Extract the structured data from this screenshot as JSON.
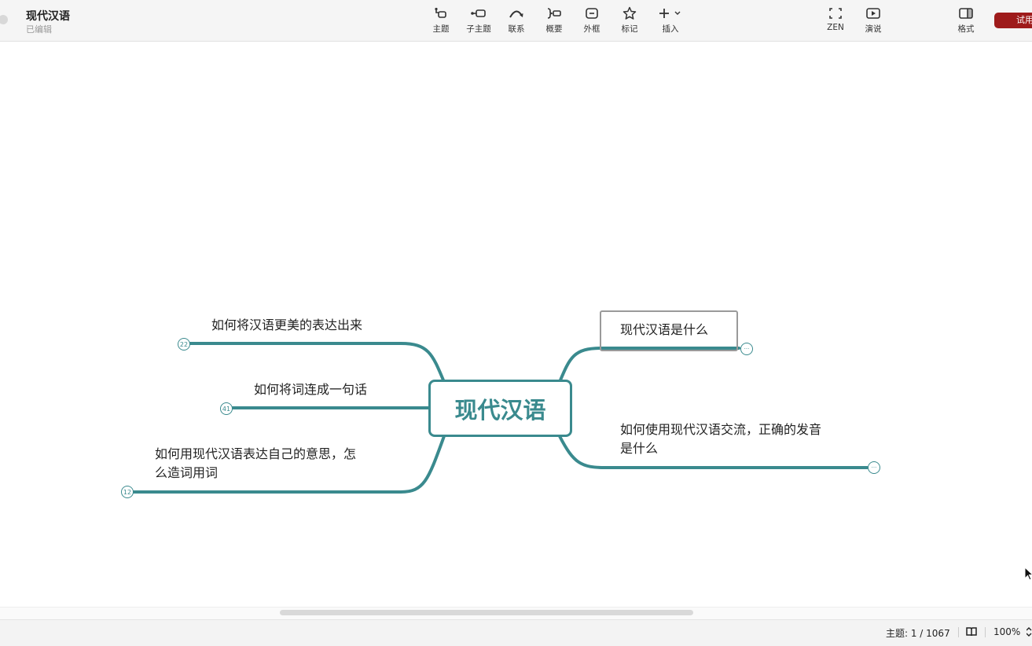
{
  "window": {
    "title": "现代汉语",
    "status": "已编辑"
  },
  "toolbar": {
    "items": [
      {
        "label": "主题",
        "icon": "topic-icon"
      },
      {
        "label": "子主题",
        "icon": "subtopic-icon"
      },
      {
        "label": "联系",
        "icon": "relationship-icon"
      },
      {
        "label": "概要",
        "icon": "summary-icon"
      },
      {
        "label": "外框",
        "icon": "boundary-icon"
      },
      {
        "label": "标记",
        "icon": "star-icon"
      },
      {
        "label": "插入",
        "icon": "plus-icon"
      }
    ],
    "zen_label": "ZEN",
    "present_label": "演说",
    "format_label": "格式",
    "trial_label": "试用"
  },
  "mindmap": {
    "central_topic": "现代汉语",
    "accent_color": "#3a8a8e",
    "left_branches": [
      {
        "text": "如何将汉语更美的表达出来",
        "collapsed_count": "22"
      },
      {
        "text": "如何将词连成一句话",
        "collapsed_count": "41"
      },
      {
        "text_line1": "如何用现代汉语表达自己的意思，怎",
        "text_line2": "么造词用词",
        "collapsed_count": "12"
      }
    ],
    "right_branches": [
      {
        "text": "现代汉语是什么",
        "collapsed_indicator": "···",
        "selected": true
      },
      {
        "text_line1": "如何使用现代汉语交流，正确的发音",
        "text_line2": "是什么",
        "collapsed_indicator": "···"
      }
    ]
  },
  "statusbar": {
    "topics": "主题: 1 / 1067",
    "zoom": "100%"
  }
}
